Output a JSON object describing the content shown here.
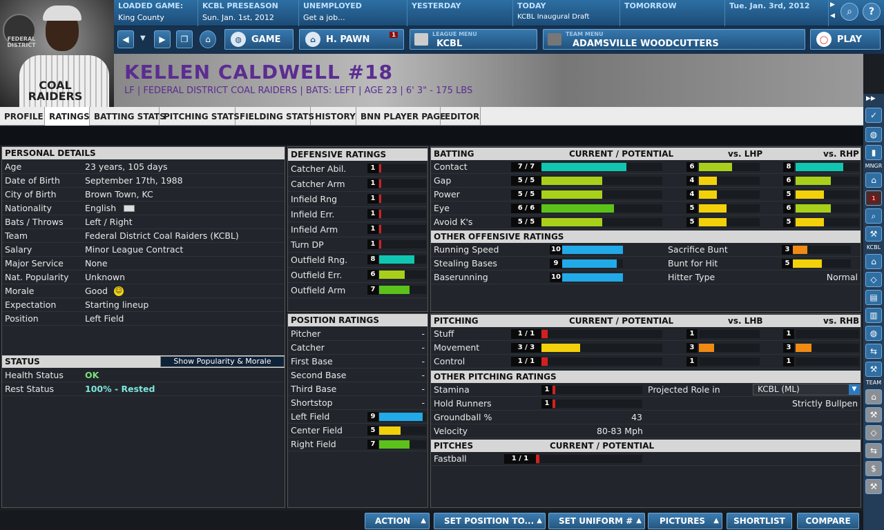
{
  "topbar": {
    "loaded_game_label": "LOADED GAME:",
    "loaded_game_value": "King County",
    "season_label": "KCBL PRESEASON",
    "season_value": "Sun. Jan. 1st, 2012",
    "employment_label": "UNEMPLOYED",
    "employment_value": "Get a job...",
    "yesterday_label": "YESTERDAY",
    "today_label": "TODAY",
    "today_value": "KCBL Inaugural Draft",
    "tomorrow_label": "TOMORROW",
    "date_label": "Tue. Jan. 3rd, 2012"
  },
  "nav": {
    "game_label": "GAME",
    "hpawn_label": "H. PAWN",
    "hpawn_badge": "1",
    "league_menu_sub": "LEAGUE MENU",
    "league_menu_label": "KCBL",
    "team_menu_sub": "TEAM MENU",
    "team_menu_label": "ADAMSVILLE WOODCUTTERS",
    "play_label": "PLAY"
  },
  "player": {
    "name": "KELLEN CALDWELL  #18",
    "info": "LF | FEDERAL DISTRICT COAL RAIDERS | BATS: LEFT | AGE 23 | 6' 3\" - 175 LBS",
    "portrait_text": "COAL RAIDERS",
    "logo_text": "FEDERAL DISTRICT"
  },
  "tabs": [
    "PROFILE",
    "RATINGS",
    "BATTING STATS",
    "PITCHING STATS",
    "FIELDING STATS",
    "HISTORY",
    "BNN PLAYER PAGE",
    "EDITOR"
  ],
  "personal": {
    "title": "PERSONAL DETAILS",
    "rows": [
      {
        "label": "Age",
        "value": "23 years, 105 days"
      },
      {
        "label": "Date of Birth",
        "value": "September 17th, 1988"
      },
      {
        "label": "City of Birth",
        "value": "Brown Town, KC"
      },
      {
        "label": "Nationality",
        "value": "English"
      },
      {
        "label": "Bats / Throws",
        "value": "Left / Right"
      },
      {
        "label": "Team",
        "value": "Federal District Coal Raiders (KCBL)"
      },
      {
        "label": "Salary",
        "value": "Minor League Contract"
      },
      {
        "label": "Major Service",
        "value": "None"
      },
      {
        "label": "Nat. Popularity",
        "value": "Unknown"
      },
      {
        "label": "Morale",
        "value": "Good"
      },
      {
        "label": "Expectation",
        "value": "Starting lineup"
      },
      {
        "label": "Position",
        "value": "Left Field"
      }
    ]
  },
  "status": {
    "title": "STATUS",
    "button": "Show Popularity & Morale",
    "health_label": "Health Status",
    "health_value": "OK",
    "rest_label": "Rest Status",
    "rest_value": "100% - Rested"
  },
  "defensive": {
    "title": "DEFENSIVE RATINGS",
    "rows": [
      {
        "label": "Catcher Abil.",
        "value": "1",
        "level": 0.05
      },
      {
        "label": "Catcher Arm",
        "value": "1",
        "level": 0.05
      },
      {
        "label": "Infield Rng",
        "value": "1",
        "level": 0.05
      },
      {
        "label": "Infield Err.",
        "value": "1",
        "level": 0.05
      },
      {
        "label": "Infield Arm",
        "value": "1",
        "level": 0.05
      },
      {
        "label": "Turn DP",
        "value": "1",
        "level": 0.05
      },
      {
        "label": "Outfield Rng.",
        "value": "8",
        "level": 0.75
      },
      {
        "label": "Outfield Err.",
        "value": "6",
        "level": 0.55
      },
      {
        "label": "Outfield Arm",
        "value": "7",
        "level": 0.65
      }
    ]
  },
  "position": {
    "title": "POSITION RATINGS",
    "rows": [
      {
        "label": "Pitcher",
        "value": "-"
      },
      {
        "label": "Catcher",
        "value": "-"
      },
      {
        "label": "First Base",
        "value": "-"
      },
      {
        "label": "Second Base",
        "value": "-"
      },
      {
        "label": "Third Base",
        "value": "-"
      },
      {
        "label": "Shortstop",
        "value": "-"
      },
      {
        "label": "Left Field",
        "value": "9",
        "level": 0.92
      },
      {
        "label": "Center Field",
        "value": "5",
        "level": 0.45
      },
      {
        "label": "Right Field",
        "value": "7",
        "level": 0.65
      }
    ]
  },
  "batting": {
    "title": "BATTING",
    "col_cp": "CURRENT / POTENTIAL",
    "col_l": "vs. LHP",
    "col_r": "vs. RHP",
    "rows": [
      {
        "label": "Contact",
        "cp": "7 / 7",
        "cp_level": 0.7,
        "l": "6",
        "l_level": 0.55,
        "r": "8",
        "r_level": 0.75
      },
      {
        "label": "Gap",
        "cp": "5 / 5",
        "cp_level": 0.5,
        "l": "4",
        "l_level": 0.3,
        "r": "6",
        "r_level": 0.55
      },
      {
        "label": "Power",
        "cp": "5 / 5",
        "cp_level": 0.5,
        "l": "4",
        "l_level": 0.3,
        "r": "5",
        "r_level": 0.45
      },
      {
        "label": "Eye",
        "cp": "6 / 6",
        "cp_level": 0.6,
        "l": "5",
        "l_level": 0.45,
        "r": "6",
        "r_level": 0.55
      },
      {
        "label": "Avoid K's",
        "cp": "5 / 5",
        "cp_level": 0.5,
        "l": "5",
        "l_level": 0.45,
        "r": "5",
        "r_level": 0.45
      }
    ]
  },
  "offensive": {
    "title": "OTHER OFFENSIVE RATINGS",
    "running_label": "Running Speed",
    "running_value": "10",
    "running_level": 1.0,
    "stealing_label": "Stealing Bases",
    "stealing_value": "9",
    "stealing_level": 0.9,
    "baserun_label": "Baserunning",
    "baserun_value": "10",
    "baserun_level": 1.0,
    "sac_label": "Sacrifice Bunt",
    "sac_value": "3",
    "sac_level": 0.25,
    "bunt_label": "Bunt for Hit",
    "bunt_value": "5",
    "bunt_level": 0.5,
    "hitter_label": "Hitter Type",
    "hitter_value": "Normal"
  },
  "pitching": {
    "title": "PITCHING",
    "col_cp": "CURRENT / POTENTIAL",
    "col_l": "vs. LHB",
    "col_r": "vs. RHB",
    "rows": [
      {
        "label": "Stuff",
        "cp": "1 / 1",
        "cp_level": 0.05,
        "l": "1",
        "l_level": 0,
        "r": "1",
        "r_level": 0
      },
      {
        "label": "Movement",
        "cp": "3 / 3",
        "cp_level": 0.32,
        "l": "3",
        "l_level": 0.25,
        "r": "3",
        "r_level": 0.25
      },
      {
        "label": "Control",
        "cp": "1 / 1",
        "cp_level": 0.05,
        "l": "1",
        "l_level": 0,
        "r": "1",
        "r_level": 0
      }
    ]
  },
  "other_pitching": {
    "title": "OTHER PITCHING RATINGS",
    "stamina_label": "Stamina",
    "stamina_value": "1",
    "stamina_level": 0.03,
    "hold_label": "Hold Runners",
    "hold_value": "1",
    "hold_level": 0.03,
    "gb_label": "Groundball %",
    "gb_value": "43",
    "velo_label": "Velocity",
    "velo_value": "80-83 Mph",
    "role_label": "Projected Role in",
    "role_select": "KCBL (ML)",
    "role_value": "Strictly Bullpen"
  },
  "pitches": {
    "title": "PITCHES",
    "col_cp": "CURRENT / POTENTIAL",
    "rows": [
      {
        "label": "Fastball",
        "cp": "1 / 1",
        "cp_level": 0.03
      }
    ]
  },
  "sidebar": {
    "mngr": "MNGR",
    "kcbl": "KCBL",
    "team": "TEAM",
    "badge": "1"
  },
  "bottom": {
    "action": "ACTION",
    "setpos": "SET POSITION TO...",
    "uniform": "SET UNIFORM #",
    "pictures": "PICTURES",
    "shortlist": "SHORTLIST",
    "compare": "COMPARE"
  },
  "colors": {
    "green": "#5cc21a",
    "yellow": "#f2d10a",
    "cyan": "#10c6b0",
    "blue": "#22a9e8",
    "orange": "#f08a14",
    "red": "#d42020",
    "lime": "#a8d01a"
  }
}
